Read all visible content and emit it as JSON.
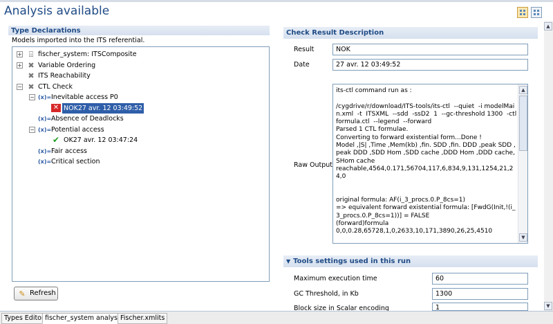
{
  "page": {
    "title": "Analysis available"
  },
  "type_declarations": {
    "header": "Type Declarations",
    "description": "Models imported into the ITS referential.",
    "tree": {
      "root": "fischer_system: ITSComposite",
      "variable_ordering": "Variable Ordering",
      "its_reachability": "ITS Reachability",
      "ctl_check": "CTL Check",
      "inevitable_access": "Inevitable access P0",
      "inevitable_result": "NOK27 avr. 12 03:49:52",
      "absence_deadlocks": "Absence of Deadlocks",
      "potential_access": "Potential access",
      "potential_result": "OK27 avr. 12 03:47:24",
      "fair_access": "Fair access",
      "critical_section": "Critical section"
    },
    "refresh_label": "Refresh"
  },
  "check_result": {
    "header": "Check Result Description",
    "result_label": "Result",
    "result_value": "NOK",
    "date_label": "Date",
    "date_value": "27 avr. 12 03:49:52",
    "raw_output_label": "Raw Output",
    "raw_output": "its-ctl command run as :\n\n/cygdrive/r/download/ITS-tools/its-ctl  --quiet  -i modelMain.xml  -t  ITSXML  --sdd  -ssD2  1  --gc-threshold 1300  -ctl  formula.ctl  --legend  --forward\nParsed 1 CTL formulae.\nConverting to forward existential form...Done !\nModel ,|S| ,Time ,Mem(kb) ,fin. SDD ,fin. DDD ,peak SDD ,peak DDD ,SDD Hom ,SDD cache ,DDD Hom ,DDD cache,SHom cache\nreachable,4564,0.171,56704,117,6,834,9,131,1254,21,24,0\n\n\noriginal formula: AF(i_3_procs.0.P_8cs=1)\n=> equivalent forward existential formula: [FwdG(Init,!(i_3_procs.0.P_8cs=1))] = FALSE\n(forward)formula\n0,0,0.28,65728,1,0,2633,10,171,3890,26,25,4510"
  },
  "tools_settings": {
    "header": "Tools settings used in this run",
    "max_exec_label": "Maximum execution time",
    "max_exec_value": "60",
    "gc_label": "GC Threshold, in Kb",
    "gc_value": "1300",
    "block_label": "Block size in Scalar encoding",
    "block_value": "1"
  },
  "tabs": {
    "types_editor": "Types Editor",
    "analysis": "fischer_system analysis",
    "xmlits": "Fischer.xmlits"
  },
  "colors": {
    "accent": "#1f4b86",
    "selection": "#2f5ea9",
    "error": "#d72828",
    "ok": "#1e9b1e"
  }
}
